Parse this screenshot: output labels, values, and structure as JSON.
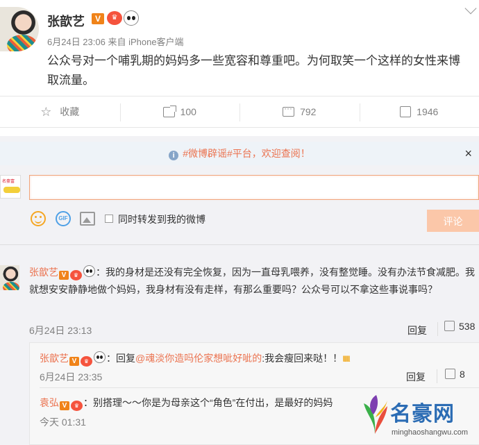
{
  "post": {
    "author": "张歆艺",
    "badge_v": "V",
    "time": "6月24日 23:06",
    "source": "来自 iPhone客户端",
    "text": "公众号对一个哺乳期的妈妈多一些宽容和尊重吧。为何取笑一个这样的女性来博取流量。"
  },
  "actions": {
    "favorite": "收藏",
    "forward": "100",
    "comment": "792",
    "like": "1946"
  },
  "comment_box": {
    "notice": "#微博辟谣#平台，欢迎查阅！",
    "notice_close": "×",
    "forward_label": "同时转发到我的微博",
    "submit": "评论",
    "gif_label": "GIF",
    "mini_avatar_text": "名豪富"
  },
  "comments": [
    {
      "author": "张歆艺",
      "text": "：我的身材是还没有完全恢复，因为一直母乳喂养，没有整觉睡。没有办法节食减肥。我就想安安静静地做个妈妈，我身材有没有走样，有那么重要吗？公众号可以不拿这些事说事吗？",
      "time": "6月24日 23:13",
      "reply": "回复",
      "likes": "538",
      "replies": [
        {
          "author": "张歆艺",
          "prefix": "：回复",
          "mention": "@魂淡你造吗伦家想呲好呲的",
          "text": ":我会瘦回来哒！！",
          "emoji": "ιιιι",
          "time": "6月24日 23:35",
          "reply": "回复",
          "likes": "8"
        },
        {
          "author": "袁弘",
          "text": "：别搭理～～你是为母亲这个“角色”在付出，是最好的妈妈",
          "time": "今天 01:31"
        }
      ]
    }
  ],
  "watermark": {
    "title": "名豪网",
    "url": "minghaoshangwu.com"
  },
  "colors": {
    "accent": "#eb7350",
    "submit_disabled": "#fbc7a9",
    "notice_bg": "#eef3f8",
    "area_bg": "#f2f2f5"
  }
}
